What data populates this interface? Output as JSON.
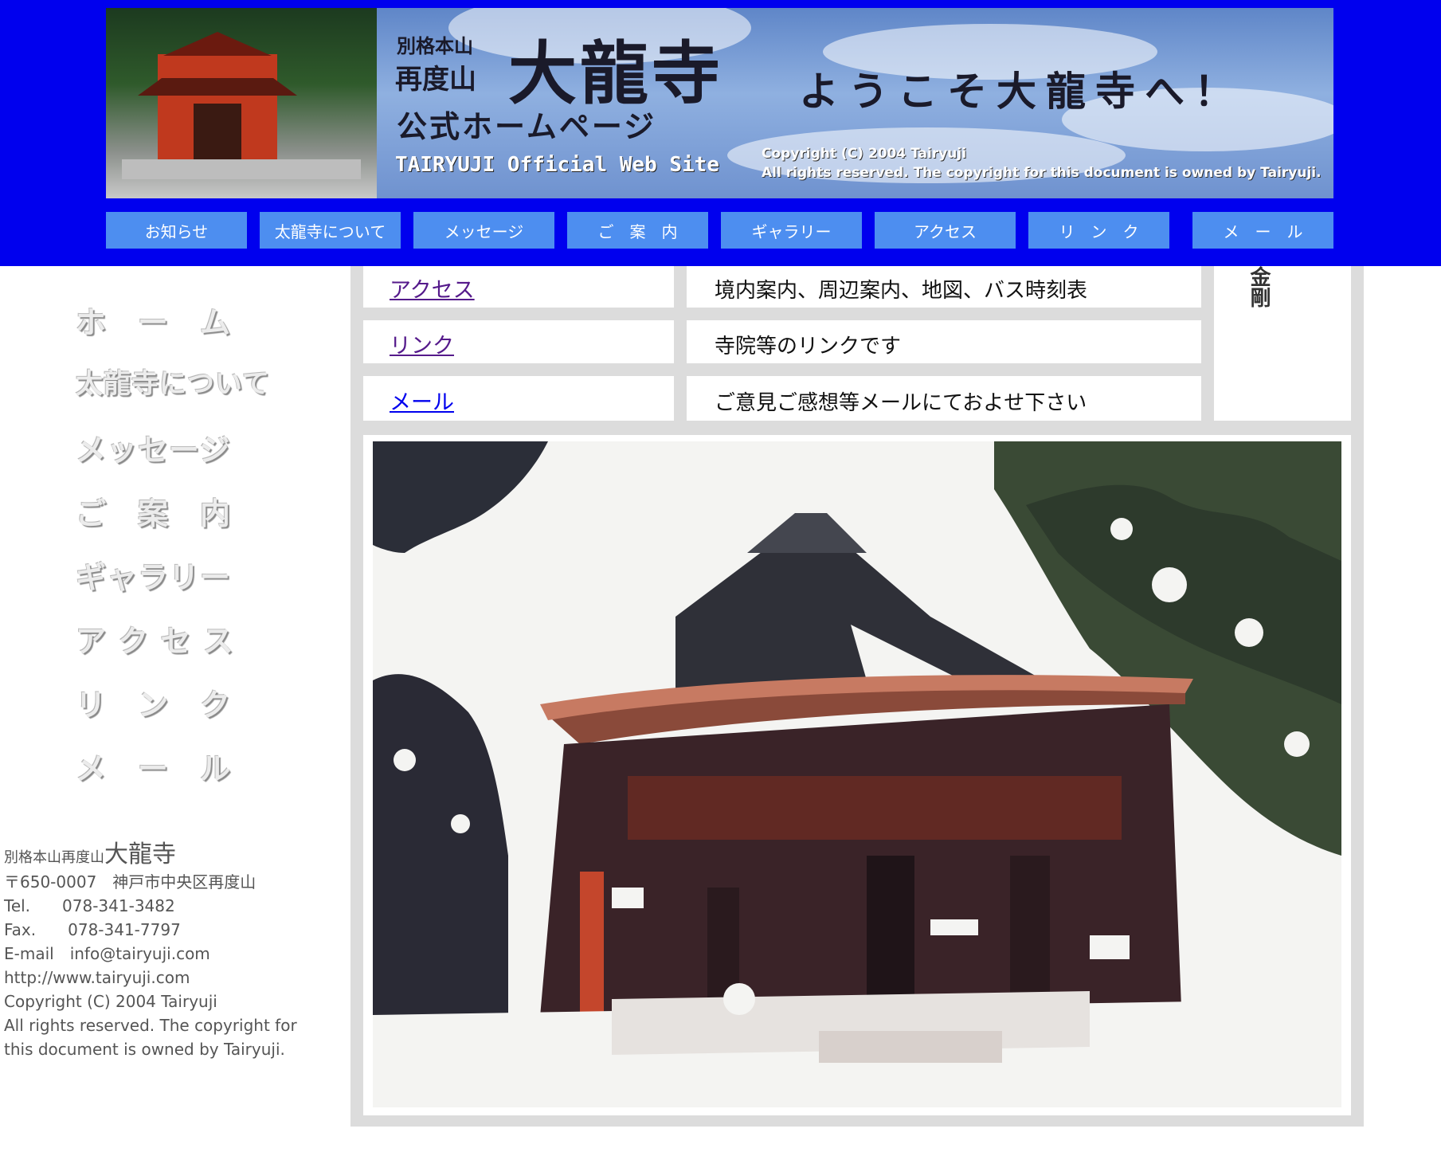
{
  "banner": {
    "line_small1": "別格本山",
    "line_small2": "再度山",
    "temple_name": "大龍寺",
    "homepage": "公式ホームページ",
    "english": "TAIRYUJI Official Web Site",
    "welcome": "ようこそ大龍寺へ！",
    "copyright_line1": "Copyright (C) 2004 Tairyuji",
    "copyright_line2": "All rights reserved. The copyright for this document is owned by Tairyuji."
  },
  "topnav": [
    {
      "label": "お知らせ"
    },
    {
      "label": "太龍寺について"
    },
    {
      "label": "メッセージ"
    },
    {
      "label": "ご　案　内"
    },
    {
      "label": "ギャラリー"
    },
    {
      "label": "アクセス"
    },
    {
      "label": "リ　ン　ク"
    },
    {
      "label": "メ　ー　ル"
    }
  ],
  "sidebar": [
    {
      "label": "ホ　ー　ム"
    },
    {
      "label": "太龍寺について"
    },
    {
      "label": "メッセージ"
    },
    {
      "label": "ご　案　内"
    },
    {
      "label": "ギャラリー"
    },
    {
      "label": "ア ク セ ス"
    },
    {
      "label": "リ　ン　ク"
    },
    {
      "label": "メ　ー　ル"
    }
  ],
  "address": {
    "prefix": "別格本山再度山",
    "name": "大龍寺",
    "postal": "〒650-0007　神戸市中央区再度山",
    "tel": "Tel.　　078-341-3482",
    "fax": "Fax.　　078-341-7797",
    "email": "E-mail　info@tairyuji.com",
    "url": "http://www.tairyuji.com",
    "copyright": "Copyright (C) 2004 Tairyuji",
    "rights": "All rights reserved. The copyright for this document is owned by Tairyuji."
  },
  "content_rows": [
    {
      "link": "アクセス",
      "desc": "境内案内、周辺案内、地図、バス時刻表",
      "link_color": "#551a8b"
    },
    {
      "link": "リンク",
      "desc": "寺院等のリンクです",
      "link_color": "#551a8b"
    },
    {
      "link": "メール",
      "desc": "ご意見ご感想等メールにておよせ下さい",
      "link_color": "#0000ee"
    }
  ],
  "vertical_text": "金剛",
  "colors": {
    "header_bg": "#0000ee",
    "nav_button": "#4d8ef0",
    "panel_bg": "#dcdcdc"
  }
}
